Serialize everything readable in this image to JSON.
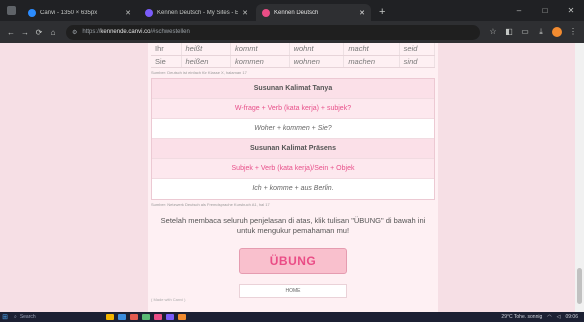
{
  "browser": {
    "tabs": [
      {
        "title": "Canvi - 1350 × 635px",
        "color": "#2b8cff"
      },
      {
        "title": "Kennen Deutsch - My Sites - E",
        "color": "#7a5cfa"
      },
      {
        "title": "Kennen Deutsch",
        "color": "#ea4d86"
      }
    ],
    "new_tab": "+",
    "win": {
      "min": "–",
      "max": "□",
      "close": "✕"
    },
    "nav": {
      "back": "←",
      "fwd": "→",
      "reload": "⟳",
      "home": "⌂"
    },
    "url_prefix": "https://",
    "url_host": "kennende.canvi.co",
    "url_path": "/#schwestellen"
  },
  "page": {
    "conj_rows": [
      [
        "Ihr",
        "heißt",
        "kommt",
        "wohnt",
        "macht",
        "seid"
      ],
      [
        "Sie",
        "heißen",
        "kommen",
        "wohnen",
        "machen",
        "sind"
      ]
    ],
    "source1": "Sumber: Deutsch ist einfach für Klasse X, halaman 17",
    "box": [
      {
        "t": "Susunan Kalimat Tanya",
        "k": "hd"
      },
      {
        "t": "W-frage + Verb (kata kerja) + subjek?",
        "k": "pk"
      },
      {
        "t": "Woher + kommen + Sie?",
        "k": "ex"
      },
      {
        "t": "Susunan Kalimat Präsens",
        "k": "hd"
      },
      {
        "t": "Subjek + Verb (kata kerja)/Sein + Objek",
        "k": "pk"
      },
      {
        "t": "Ich + komme + aus Berlin.",
        "k": "ex"
      }
    ],
    "source2": "Sumber: Netzwerk Deutsch als Fremdsprache Kursbuch A1, hal 17",
    "paragraph": "Setelah membaca seluruh penjelasan di atas, klik tulisan \"ÜBUNG\" di bawah ini untuk mengukur pemahaman mu!",
    "ubung": "ÜBUNG",
    "home": "HOME",
    "made": "( Made with Canvi )"
  },
  "taskbar": {
    "search": "Search",
    "weather": "29°C Tohe. sonnig",
    "time": "09:06"
  }
}
